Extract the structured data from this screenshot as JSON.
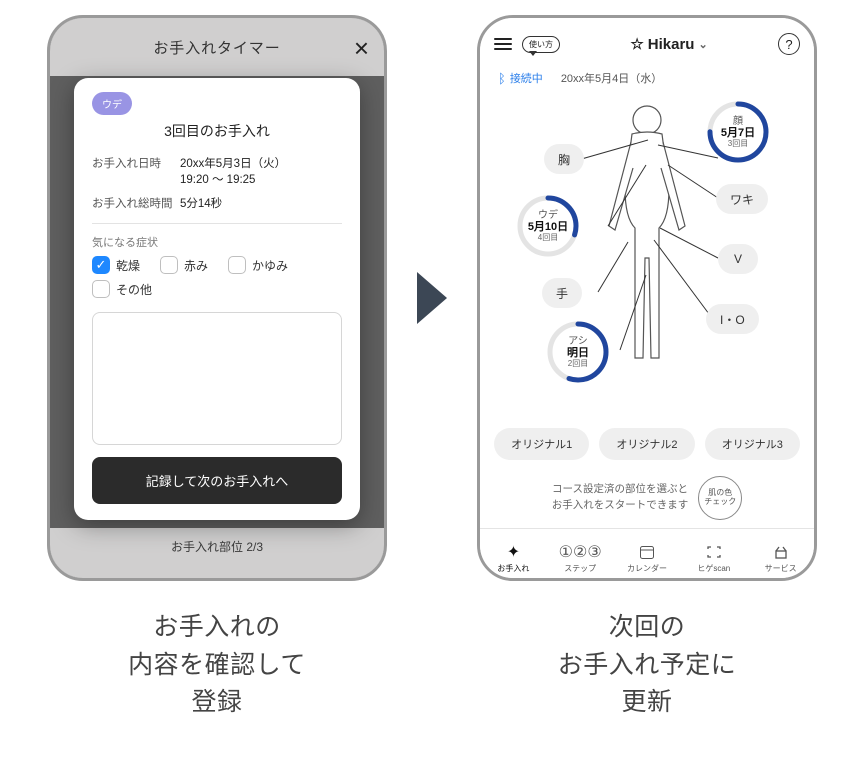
{
  "phone1": {
    "header_title": "お手入れタイマー",
    "chip": "ウデ",
    "card_title": "3回目のお手入れ",
    "dt_label": "お手入れ日時",
    "dt_val1": "20xx年5月3日（火）",
    "dt_val2": "19:20 ～ 19:25",
    "total_label": "お手入れ総時間",
    "total_val": "5分14秒",
    "symptom_label": "気になる症状",
    "checks": {
      "dry": {
        "label": "乾燥",
        "on": true
      },
      "red": {
        "label": "赤み",
        "on": false
      },
      "itch": {
        "label": "かゆみ",
        "on": false
      },
      "other": {
        "label": "その他",
        "on": false
      }
    },
    "cta": "記録して次のお手入れへ",
    "footer": "お手入れ部位 2/3"
  },
  "phone2": {
    "howto": "使い方",
    "user": "Hikaru",
    "bt_status": "接続中",
    "date": "20xx年5月4日（水）",
    "parts": {
      "chest": {
        "label": "胸"
      },
      "armpit": {
        "label": "ワキ"
      },
      "hand": {
        "label": "手"
      },
      "vline": {
        "label": "V"
      },
      "io": {
        "label": "I・O"
      }
    },
    "rings": {
      "face": {
        "t1": "顔",
        "t2": "5月7日",
        "t3": "3回目",
        "pct": 0.75
      },
      "arm": {
        "t1": "ウデ",
        "t2": "5月10日",
        "t3": "4回目",
        "pct": 0.3
      },
      "leg": {
        "t1": "アシ",
        "t2": "明日",
        "t3": "2回目",
        "pct": 0.55
      }
    },
    "originals": {
      "o1": "オリジナル1",
      "o2": "オリジナル2",
      "o3": "オリジナル3"
    },
    "hint1": "コース設定済の部位を選ぶと",
    "hint2": "お手入れをスタートできます",
    "skin1": "肌の色",
    "skin2": "チェック",
    "tabs": {
      "care": "お手入れ",
      "step": "ステップ",
      "calendar": "カレンダー",
      "higescan": "ヒゲscan",
      "service": "サービス"
    }
  },
  "captions": {
    "left": "お手入れの\n内容を確認して\n登録",
    "right": "次回の\nお手入れ予定に\n更新"
  }
}
